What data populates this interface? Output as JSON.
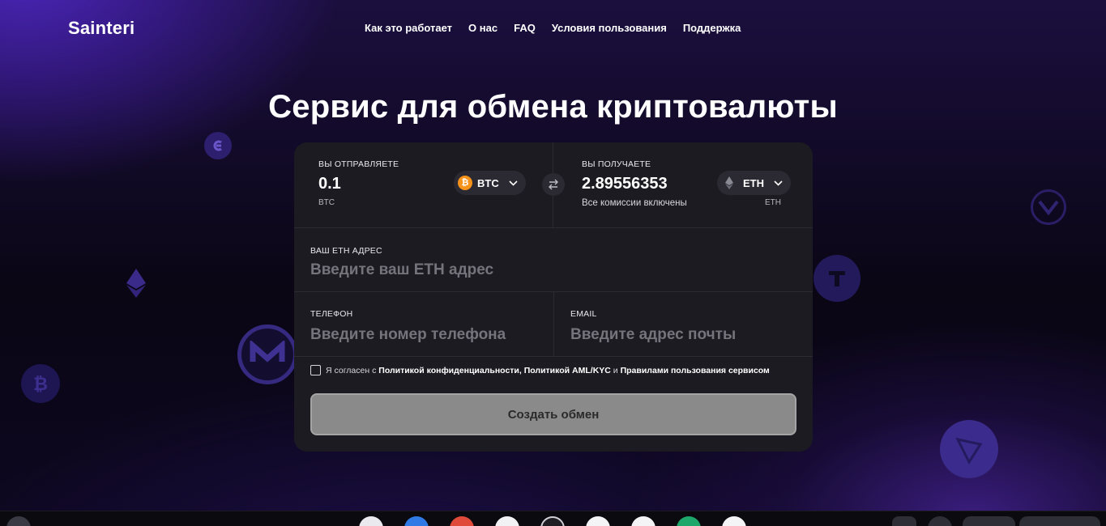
{
  "brand": "Sainteri",
  "nav": [
    "Как это работает",
    "О нас",
    "FAQ",
    "Условия пользования",
    "Поддержка"
  ],
  "headline": "Сервис для обмена криптовалюты",
  "send": {
    "label": "ВЫ ОТПРАВЛЯЕТЕ",
    "amount": "0.1",
    "unit": "BTC",
    "coin": "BTC",
    "coin_icon": "bitcoin-icon",
    "coin_color": "#f7931a"
  },
  "receive": {
    "label": "ВЫ ПОЛУЧАЕТЕ",
    "amount": "2.89556353",
    "note": "Все комиссии включены",
    "unit": "ETH",
    "coin": "ETH",
    "coin_icon": "ethereum-icon"
  },
  "address": {
    "label": "ВАШ ETH АДРЕС",
    "placeholder": "Введите ваш ETH адрес"
  },
  "phone": {
    "label": "ТЕЛЕФОН",
    "placeholder": "Введите номер телефона"
  },
  "email": {
    "label": "EMAIL",
    "placeholder": "Введите адрес почты"
  },
  "agreement": {
    "prefix": "Я согласен с",
    "link1": "Политикой конфиденциальности,",
    "link2": "Политикой AML/KYC",
    "conj": "и",
    "link3": "Правилами пользования сервисом"
  },
  "submit": "Создать обмен",
  "colors": {
    "card_bg": "#1c1b21",
    "button_bg": "#8a8a8a",
    "accent_purple": "#4b26b8"
  }
}
